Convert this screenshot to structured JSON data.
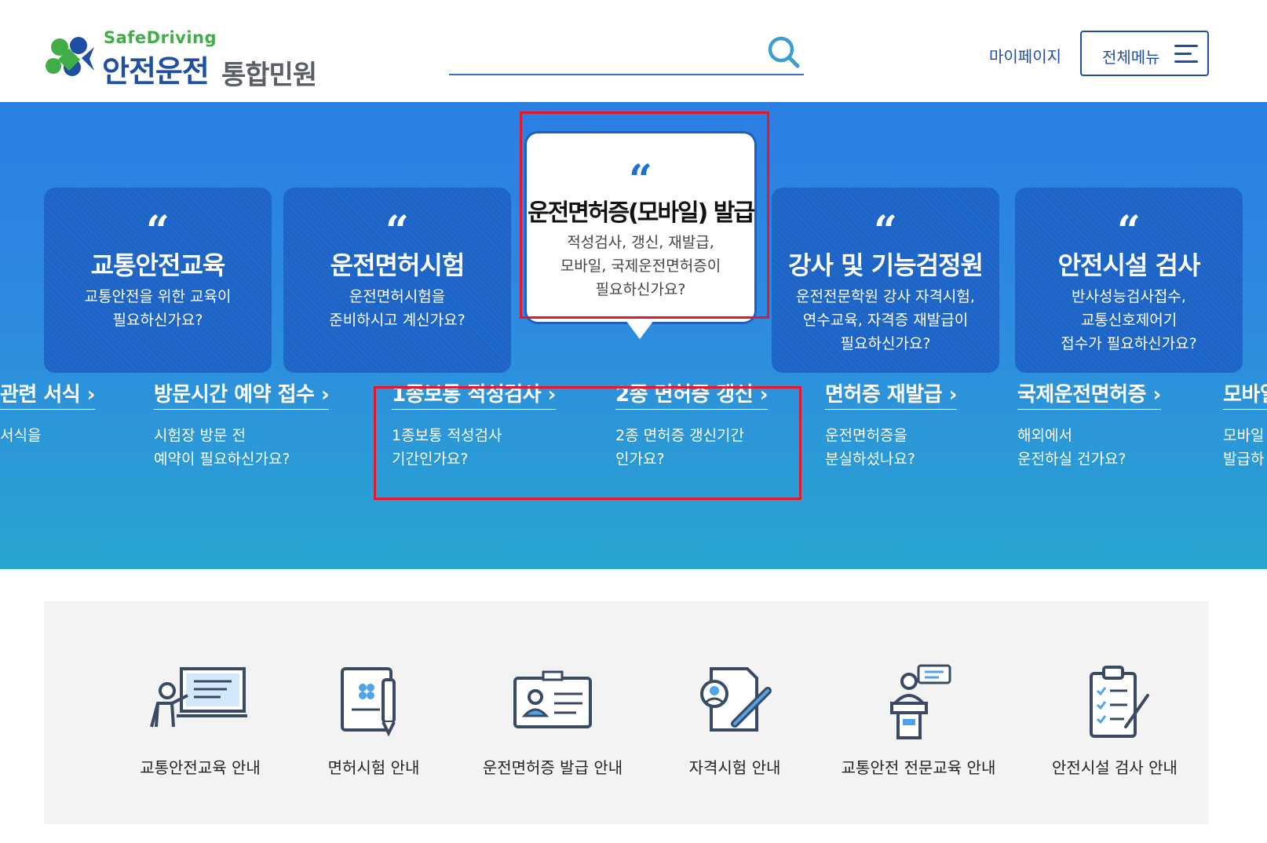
{
  "header": {
    "logo_en": "SafeDriving",
    "logo_ko_main": "안전운전",
    "logo_ko_sub": "통합민원",
    "search": {
      "value": "",
      "placeholder": ""
    },
    "mypage_label": "마이페이지",
    "allmenu_label": "전체메뉴"
  },
  "hero": {
    "cards": [
      {
        "title": "교통안전교육",
        "desc": "교통안전을 위한 교육이\n필요하신가요?"
      },
      {
        "title": "운전면허시험",
        "desc": "운전면허시험을\n준비하시고 계신가요?"
      },
      {
        "title": "운전면허증(모바일) 발급",
        "desc": "적성검사, 갱신, 재발급,\n모바일, 국제운전면허증이\n필요하신가요?",
        "active": true
      },
      {
        "title": "강사 및 기능검정원",
        "desc": "운전전문학원 강사 자격시험,\n연수교육, 자격증 재발급이\n필요하신가요?"
      },
      {
        "title": "안전시설 검사",
        "desc": "반사성능검사접수,\n교통신호제어기\n접수가 필요하신가요?"
      }
    ],
    "quote_mark": "“",
    "sub_items": [
      {
        "title": "관련 서식 ›",
        "desc": "서식을\n"
      },
      {
        "title": "방문시간 예약 접수 ›",
        "desc": "시험장 방문 전\n예약이 필요하신가요?"
      },
      {
        "title": "1종보통 적성검사 ›",
        "desc": "1종보통 적성검사\n기간인가요?"
      },
      {
        "title": "2종 면허증 갱신 ›",
        "desc": "2종 면허증 갱신기간\n인가요?"
      },
      {
        "title": "면허증 재발급 ›",
        "desc": "운전면허증을\n분실하셨나요?"
      },
      {
        "title": "국제운전면허증 ›",
        "desc": "해외에서\n운전하실 건가요?"
      },
      {
        "title": "모바일",
        "desc": "모바일\n발급하"
      }
    ],
    "highlight_color": "#e3182d"
  },
  "services": [
    {
      "label": "교통안전교육 안내",
      "icon": "lecture-board-icon"
    },
    {
      "label": "면허시험 안내",
      "icon": "exam-paper-pencil-icon"
    },
    {
      "label": "운전면허증 발급 안내",
      "icon": "id-card-icon"
    },
    {
      "label": "자격시험 안내",
      "icon": "person-document-pen-icon"
    },
    {
      "label": "교통안전 전문교육 안내",
      "icon": "speaker-podium-icon"
    },
    {
      "label": "안전시설 검사 안내",
      "icon": "checklist-clipboard-icon"
    }
  ],
  "colors": {
    "brand_blue": "#1f4fa3",
    "brand_green": "#3fae49",
    "hero_top": "#2b7fe3",
    "hero_bottom": "#28a5cf",
    "card_bg": "#1d64c7",
    "icon_navy": "#3a4a63",
    "icon_accent": "#4fa3e8"
  }
}
